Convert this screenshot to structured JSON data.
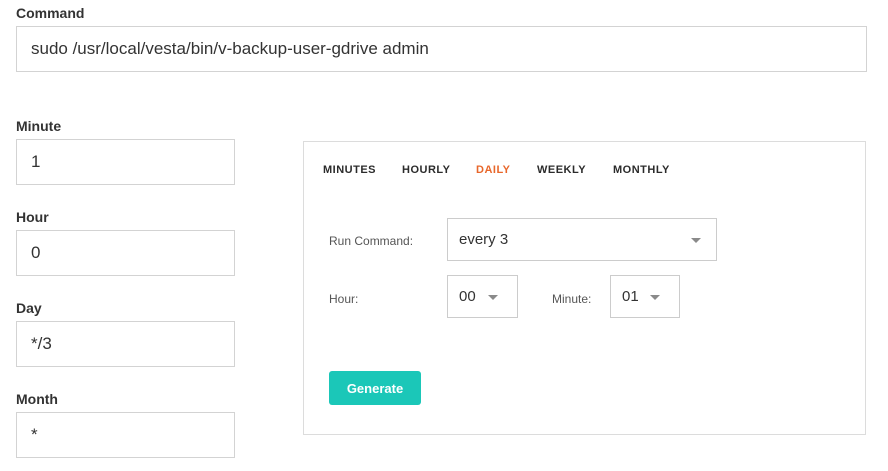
{
  "command": {
    "label": "Command",
    "value": "sudo /usr/local/vesta/bin/v-backup-user-gdrive admin"
  },
  "fields": {
    "minute": {
      "label": "Minute",
      "value": "1"
    },
    "hour": {
      "label": "Hour",
      "value": "0"
    },
    "day": {
      "label": "Day",
      "value": "*/3"
    },
    "month": {
      "label": "Month",
      "value": "*"
    }
  },
  "generator": {
    "tabs": [
      "MINUTES",
      "HOURLY",
      "DAILY",
      "WEEKLY",
      "MONTHLY"
    ],
    "active_tab": "DAILY",
    "run_command_label": "Run Command:",
    "run_command_value": "every 3",
    "hour_label": "Hour:",
    "hour_value": "00",
    "minute_label": "Minute:",
    "minute_value": "01",
    "generate_label": "Generate"
  },
  "colors": {
    "active_tab": "#e8672b",
    "generate_button": "#1bc7b8"
  },
  "icons": {
    "dropdown": "chevron-down-icon"
  }
}
